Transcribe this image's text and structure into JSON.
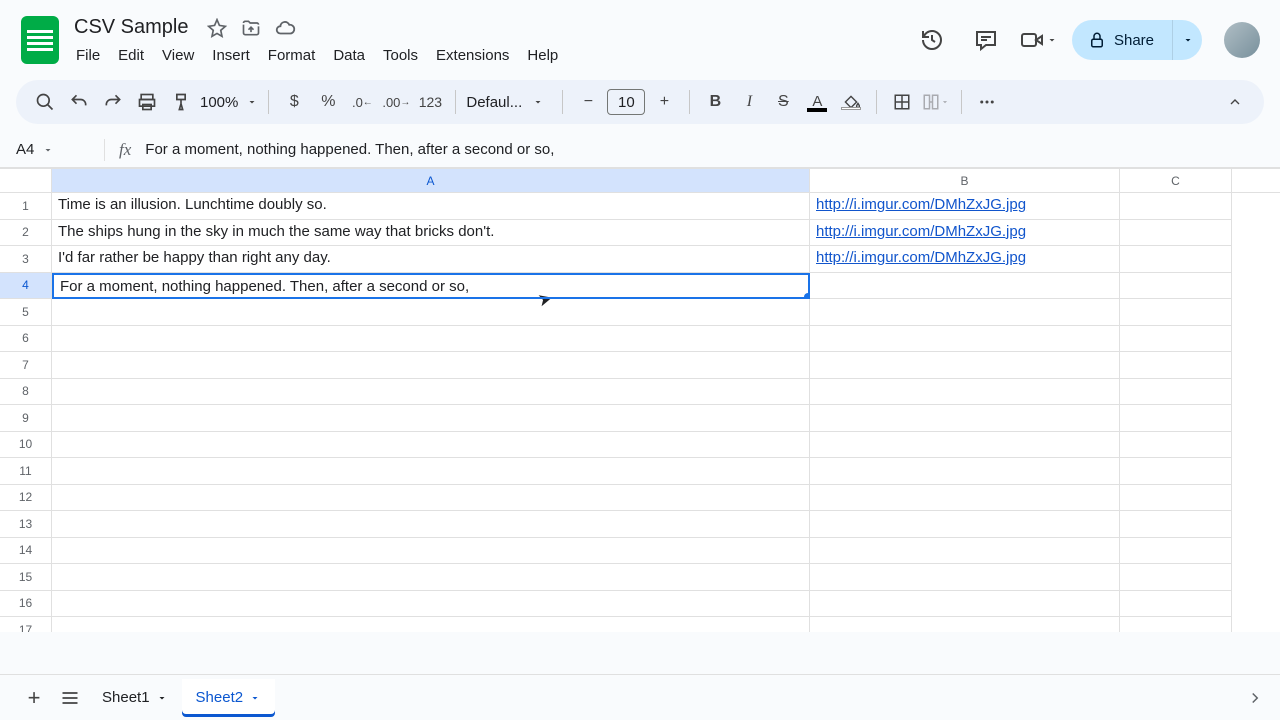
{
  "doc": {
    "title": "CSV Sample"
  },
  "menus": [
    "File",
    "Edit",
    "View",
    "Insert",
    "Format",
    "Data",
    "Tools",
    "Extensions",
    "Help"
  ],
  "share": {
    "label": "Share"
  },
  "toolbar": {
    "zoom": "100%",
    "font": "Defaul...",
    "font_size": "10",
    "format123": "123"
  },
  "namebox": {
    "cell": "A4"
  },
  "formula": "For a moment, nothing happened. Then, after a second or so,",
  "columns": [
    "A",
    "B",
    "C"
  ],
  "active_cell": {
    "row": 4,
    "col": "A"
  },
  "cells": {
    "A1": "Time is an illusion. Lunchtime doubly so.",
    "A2": "The ships hung in the sky in much the same way that bricks don't.",
    "A3": "I'd far rather be happy than right any day.",
    "A4": "For a moment, nothing happened. Then, after a second or so,",
    "B1": "http://i.imgur.com/DMhZxJG.jpg",
    "B2": "http://i.imgur.com/DMhZxJG.jpg",
    "B3": "http://i.imgur.com/DMhZxJG.jpg"
  },
  "row_count": 17,
  "sheets": {
    "tabs": [
      "Sheet1",
      "Sheet2"
    ],
    "active": "Sheet2"
  }
}
